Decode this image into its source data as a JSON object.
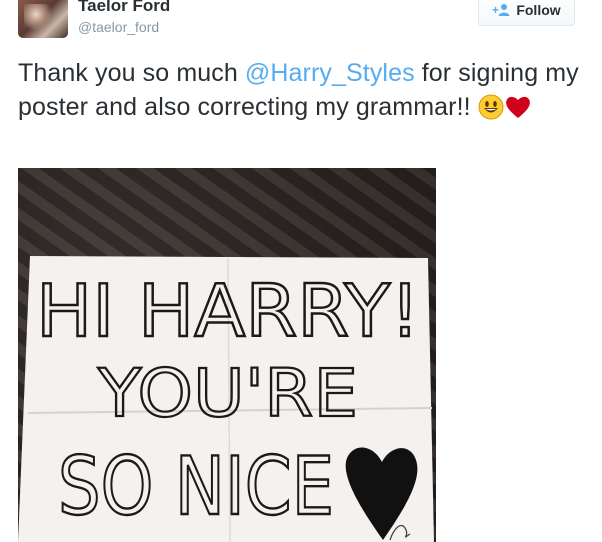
{
  "tweet": {
    "author_name": "Taelor Ford",
    "author_handle": "@taelor_ford",
    "follow_label": "Follow",
    "text_start": "Thank you so much ",
    "mention": "@Harry_Styles",
    "text_end": " for signing my poster and also correcting my grammar!! "
  },
  "photo": {
    "poster_line1": "HI HARRY!",
    "poster_line2": "YOU'RE",
    "poster_line3": "SO NICE"
  },
  "colors": {
    "link": "#55acee",
    "heart": "#d0021b"
  },
  "icons": [
    "follow-icon",
    "smiley-emoji-icon",
    "heart-emoji-icon"
  ]
}
